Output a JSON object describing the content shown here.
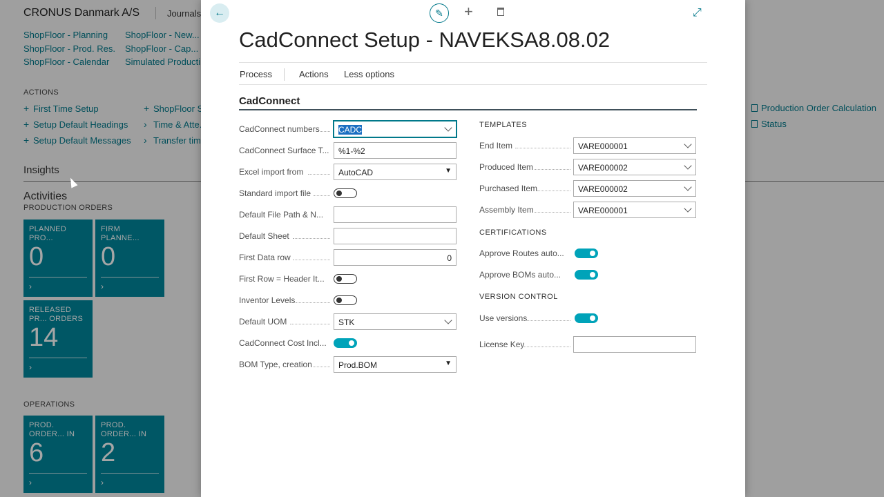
{
  "background": {
    "company": "CRONUS Danmark A/S",
    "journals": "Journals",
    "nav_links_col1": [
      "ShopFloor - Planning",
      "ShopFloor - Prod. Res.",
      "ShopFloor - Calendar"
    ],
    "nav_links_col2": [
      "ShopFloor - New...",
      "ShopFloor - Cap...",
      "Simulated Producti..."
    ],
    "actions_heading": "ACTIONS",
    "actions_col1": [
      "First Time Setup",
      "Setup Default Headings",
      "Setup Default Messages"
    ],
    "actions_col2": [
      "ShopFloor S...",
      "Time & Atte...",
      "Transfer tim..."
    ],
    "right_links": [
      "Production Order Calculation",
      "Status"
    ],
    "insights": "Insights",
    "activities": "Activities",
    "production_orders_heading": "PRODUCTION ORDERS",
    "tiles_production": [
      {
        "title": "PLANNED PRO... ORDERS - ALL",
        "value": "0"
      },
      {
        "title": "FIRM PLANNE... ORDERS - ALL",
        "value": "0"
      },
      {
        "title": "RELEASED PR... ORDERS - ALL",
        "value": "14"
      }
    ],
    "operations_heading": "OPERATIONS",
    "tiles_operations": [
      {
        "title": "PROD. ORDER... IN QUEUE -",
        "value": "6"
      },
      {
        "title": "PROD. ORDER... IN PROGRESS -",
        "value": "2"
      }
    ]
  },
  "dialog": {
    "title": "CadConnect Setup - NAVEKSA8.08.02",
    "menu": {
      "process": "Process",
      "actions": "Actions",
      "less_options": "Less options"
    },
    "fasttab": "CadConnect",
    "left_fields": [
      {
        "label": "CadConnect numbers",
        "value": "CADC"
      },
      {
        "label": "CadConnect Surface T...",
        "value": "%1-%2"
      },
      {
        "label": "Excel import from",
        "value": "AutoCAD"
      },
      {
        "label": "Standard import file",
        "value": ""
      },
      {
        "label": "Default File Path & N...",
        "value": ""
      },
      {
        "label": "Default Sheet",
        "value": ""
      },
      {
        "label": "First Data row",
        "value": "0"
      },
      {
        "label": "First Row = Header It...",
        "value": ""
      },
      {
        "label": "Inventor Levels",
        "value": ""
      },
      {
        "label": "Default UOM",
        "value": "STK"
      },
      {
        "label": "CadConnect Cost Incl...",
        "value": ""
      },
      {
        "label": "BOM Type, creation",
        "value": "Prod.BOM"
      }
    ],
    "templates_heading": "TEMPLATES",
    "templates": [
      {
        "label": "End Item",
        "value": "VARE000001"
      },
      {
        "label": "Produced Item",
        "value": "VARE000002"
      },
      {
        "label": "Purchased Item",
        "value": "VARE000002"
      },
      {
        "label": "Assembly Item",
        "value": "VARE000001"
      }
    ],
    "certifications_heading": "CERTIFICATIONS",
    "certifications": [
      {
        "label": "Approve Routes auto...",
        "value": ""
      },
      {
        "label": "Approve BOMs auto...",
        "value": ""
      }
    ],
    "version_heading": "VERSION CONTROL",
    "use_versions": "Use versions",
    "license_key": "License Key"
  }
}
